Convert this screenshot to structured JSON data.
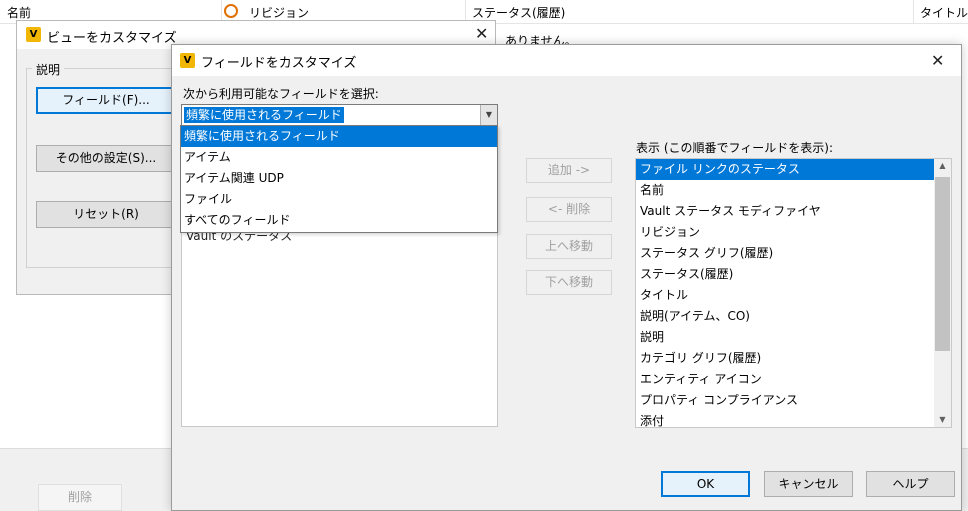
{
  "background": {
    "columns": [
      "名前",
      "リビジョン",
      "ステータス(履歴)",
      "タイトル"
    ],
    "message": "ありません。",
    "delete_button": "削除",
    "back_dialog": {
      "title": "ビューをカスタマイズ",
      "group_label": "説明",
      "buttons": [
        "フィールド(F)...",
        "その他の設定(S)...",
        "リセット(R)"
      ],
      "partial_list_text": "Vault のステータス"
    }
  },
  "dialog": {
    "title": "フィールドをカスタマイズ",
    "icon_letter": "V",
    "available_label": "次から利用可能なフィールドを選択:",
    "combo_value": "頻繁に使用されるフィールド",
    "combo_options": [
      "頻繁に使用されるフィールド",
      "アイテム",
      "アイテム関連 UDP",
      "ファイル",
      "すべてのフィールド"
    ],
    "middle_buttons": [
      "追加 ->",
      "<- 削除",
      "上へ移動",
      "下へ移動"
    ],
    "display_label": "表示 (この順番でフィールドを表示):",
    "display_fields": [
      "ファイル リンクのステータス",
      "名前",
      "Vault ステータス モディファイヤ",
      "リビジョン",
      "ステータス グリフ(履歴)",
      "ステータス(履歴)",
      "タイトル",
      "説明(アイテム、CO)",
      "説明",
      "カテゴリ グリフ(履歴)",
      "エンティティ アイコン",
      "プロパティ コンプライアンス",
      "添付"
    ],
    "ok": "OK",
    "cancel": "キャンセル",
    "help": "ヘルプ"
  },
  "colors": {
    "accent": "#0078d7",
    "vault_icon": "#f2b705"
  }
}
